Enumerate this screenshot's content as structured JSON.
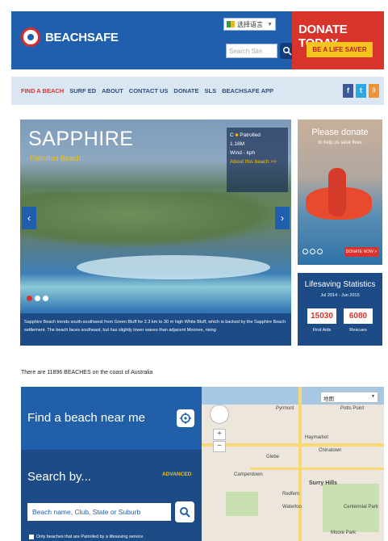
{
  "header": {
    "logo_text": "BEACHSAFE",
    "language_select": "选择语言",
    "search_placeholder": "Search Site",
    "donate_title": "DONATE TODAY",
    "donate_button": "BE A LIFE SAVER"
  },
  "nav": {
    "items": [
      "FIND A BEACH",
      "SURF ED",
      "ABOUT",
      "CONTACT US",
      "DONATE",
      "SLS",
      "BEACHSAFE APP"
    ],
    "social": [
      "f",
      "t",
      "rss"
    ]
  },
  "hero": {
    "title": "SAPPHIRE",
    "subtitle": "Patrolled Beach",
    "info": [
      "C",
      "Patrolled",
      "1.18M",
      "Wind - kph"
    ],
    "about_link": "About this beach >>",
    "caption": "Sapphire Beach trends south-southwest from Green Bluff for 2.3 km to 30 m high White Bluff, which is backed by the Sapphire Beach settlement. The beach faces southeast, but has slightly lower waves than adjacent Moonee, rising"
  },
  "ad": {
    "title": "Please donate",
    "subtitle": "to help us save lives",
    "button": "DONATE NOW >"
  },
  "stats": {
    "title": "Lifesaving Statistics",
    "dates": "Jul 2014 - Jun 2015",
    "first_aids_value": "15030",
    "first_aids_label": "First Aids",
    "rescues_value": "6080",
    "rescues_label": "Rescues"
  },
  "beach_count_text": "There are 11896 BEACHES on the coast of Australia",
  "find": {
    "title": "Find a beach near me",
    "search_by": "Search by...",
    "advanced": "ADVANCED",
    "input_value": "Beach name, Club, State or Suburb",
    "only_patrolled": "Only beaches that are Patrolled by a lifesaving service"
  },
  "map": {
    "type_select": "地图",
    "labels": [
      "Pyrmont",
      "Potts Point",
      "Haymarket",
      "Glebe",
      "Chinatown",
      "Camperdown",
      "Surry Hills",
      "Waterloo",
      "Moore Park",
      "Centennial Park",
      "Redfern"
    ]
  }
}
